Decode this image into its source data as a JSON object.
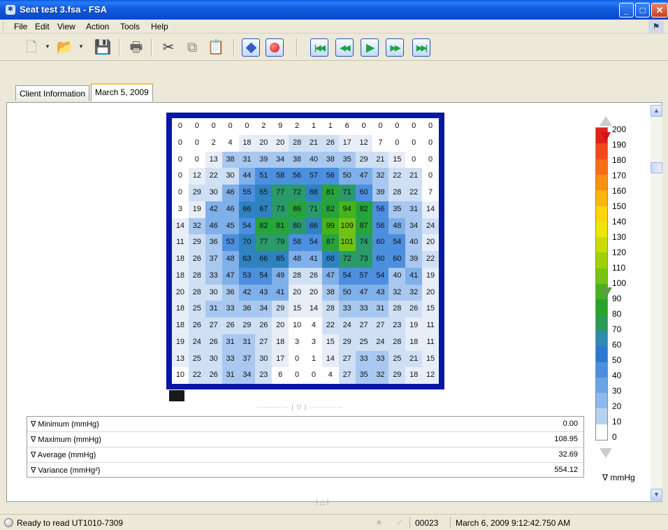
{
  "window": {
    "title": "Seat test 3.fsa - FSA"
  },
  "menu": [
    "File",
    "Edit",
    "View",
    "Action",
    "Tools",
    "Help"
  ],
  "toolbar": {
    "icons": [
      "new-file-icon",
      "open-folder-icon",
      "save-icon",
      "print-icon",
      "cut-icon",
      "copy-icon",
      "paste-icon",
      "diamond-icon",
      "record-icon",
      "first-frame-icon",
      "rewind-icon",
      "play-icon",
      "fast-forward-icon",
      "last-frame-icon"
    ]
  },
  "tabs": [
    {
      "label": "Client Information",
      "active": false
    },
    {
      "label": "March 5, 2009",
      "active": true
    }
  ],
  "pressure_map": {
    "unit": "mmHg",
    "rows": [
      [
        0,
        0,
        0,
        0,
        0,
        2,
        9,
        2,
        1,
        1,
        6,
        0,
        0,
        0,
        0,
        0
      ],
      [
        0,
        0,
        2,
        4,
        18,
        20,
        20,
        28,
        21,
        26,
        17,
        12,
        7,
        0,
        0,
        0
      ],
      [
        0,
        0,
        13,
        38,
        31,
        39,
        34,
        38,
        40,
        38,
        35,
        29,
        21,
        15,
        0,
        0
      ],
      [
        0,
        12,
        22,
        30,
        44,
        51,
        58,
        56,
        57,
        56,
        50,
        47,
        32,
        22,
        21,
        0
      ],
      [
        0,
        29,
        30,
        46,
        55,
        65,
        77,
        72,
        68,
        81,
        71,
        60,
        39,
        28,
        22,
        7
      ],
      [
        3,
        19,
        42,
        46,
        66,
        67,
        73,
        86,
        71,
        82,
        94,
        82,
        56,
        35,
        31,
        14
      ],
      [
        14,
        32,
        46,
        45,
        54,
        82,
        81,
        80,
        66,
        99,
        109,
        87,
        56,
        48,
        34,
        24
      ],
      [
        11,
        29,
        36,
        53,
        70,
        77,
        79,
        58,
        54,
        87,
        101,
        74,
        60,
        54,
        40,
        20
      ],
      [
        18,
        26,
        37,
        48,
        63,
        66,
        65,
        48,
        41,
        68,
        72,
        73,
        60,
        60,
        39,
        22
      ],
      [
        18,
        28,
        33,
        47,
        53,
        54,
        49,
        28,
        26,
        47,
        54,
        57,
        54,
        40,
        41,
        19
      ],
      [
        20,
        28,
        30,
        36,
        42,
        43,
        41,
        20,
        20,
        38,
        50,
        47,
        43,
        32,
        32,
        20
      ],
      [
        18,
        25,
        31,
        33,
        36,
        34,
        29,
        15,
        14,
        28,
        33,
        33,
        31,
        28,
        26,
        15
      ],
      [
        18,
        26,
        27,
        26,
        29,
        26,
        20,
        10,
        4,
        22,
        24,
        27,
        27,
        23,
        19,
        11
      ],
      [
        19,
        24,
        26,
        31,
        31,
        27,
        18,
        3,
        3,
        15,
        29,
        25,
        24,
        28,
        18,
        11
      ],
      [
        13,
        25,
        30,
        33,
        37,
        30,
        17,
        0,
        1,
        14,
        27,
        33,
        33,
        25,
        21,
        15
      ],
      [
        10,
        22,
        26,
        31,
        34,
        23,
        6,
        0,
        0,
        4,
        27,
        35,
        32,
        29,
        18,
        12
      ]
    ]
  },
  "stats": [
    {
      "label": "∇ Minimum (mmHg)",
      "value": "0.00"
    },
    {
      "label": "∇ Maximum (mmHg)",
      "value": "108.95"
    },
    {
      "label": "∇ Average (mmHg)",
      "value": "32.69"
    },
    {
      "label": "∇ Variance (mmHg²)",
      "value": "554.12"
    }
  ],
  "color_scale": {
    "labels": [
      "200",
      "190",
      "180",
      "170",
      "160",
      "150",
      "140",
      "130",
      "120",
      "110",
      "100",
      "90",
      "80",
      "70",
      "60",
      "50",
      "40",
      "30",
      "20",
      "10",
      "0"
    ],
    "unit": "∇ mmHg",
    "colors": [
      "#e1201c",
      "#f04a18",
      "#f46f16",
      "#f89014",
      "#fbb411",
      "#fdd40e",
      "#ede608",
      "#c9dc0a",
      "#9fd00e",
      "#75c314",
      "#45b41c",
      "#27a32a",
      "#2a9a55",
      "#2f8bb0",
      "#2d78d4",
      "#4b8fde",
      "#6ba4e4",
      "#8cbaeb",
      "#b6d2f1",
      "#ffffff"
    ]
  },
  "status": {
    "text": "Ready to read UT1010-7309",
    "frame": "00023",
    "datetime": "March 6, 2009 9:12:42.750 AM"
  }
}
